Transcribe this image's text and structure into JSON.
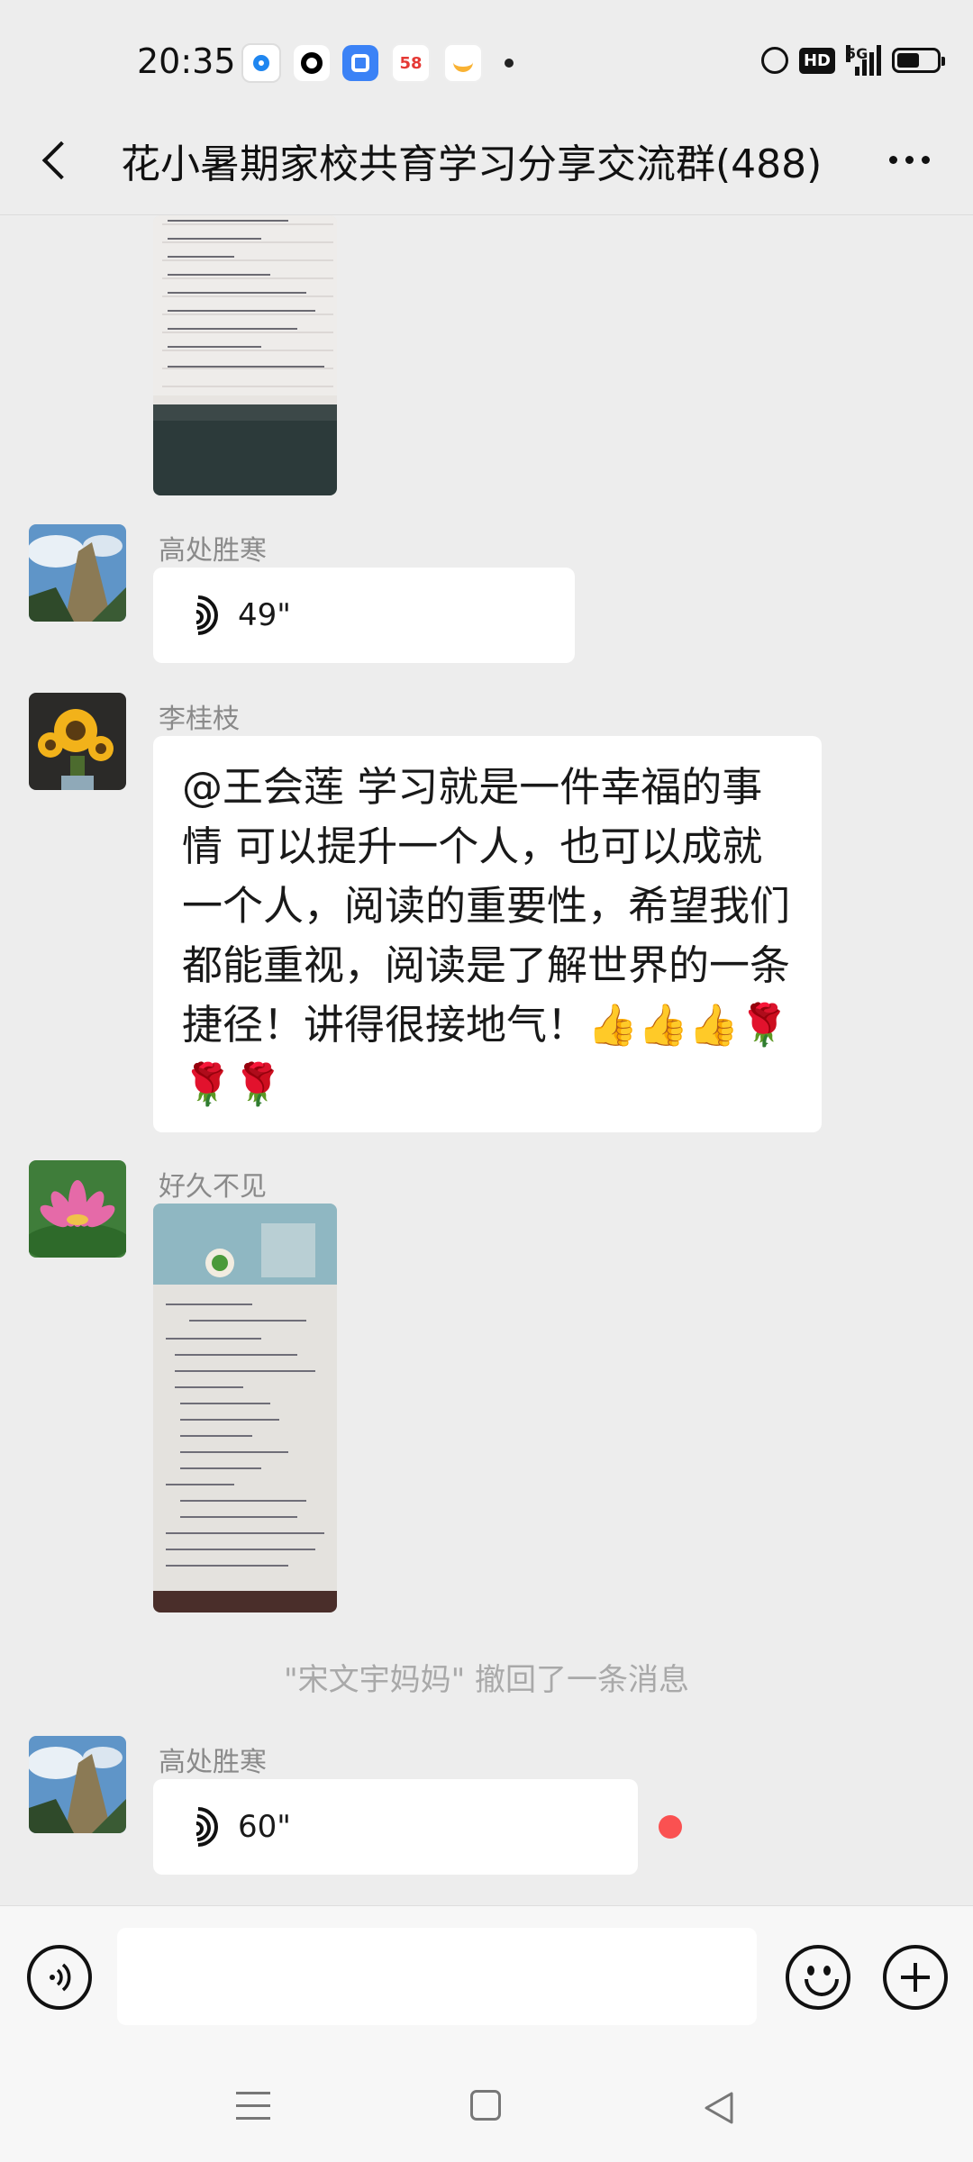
{
  "status_bar": {
    "time": "20:35",
    "notif_58": "58",
    "hd": "HD",
    "network": "5G"
  },
  "header": {
    "title": "花小暑期家校共育学习分享交流群(488)"
  },
  "messages": [
    {
      "type": "image",
      "sender": "",
      "avatar": ""
    },
    {
      "type": "voice",
      "sender": "高处胜寒",
      "duration": "49\"",
      "avatar": "mountain-landscape"
    },
    {
      "type": "text",
      "sender": "李桂枝",
      "text": "@王会莲  学习就是一件幸福的事情 可以提升一个人，也可以成就一个人，阅读的重要性，希望我们都能重视，阅读是了解世界的一条捷径！讲得很接地气！👍👍👍🌹🌹🌹",
      "avatar": "sunflower"
    },
    {
      "type": "image",
      "sender": "好久不见",
      "avatar": "lotus-flower"
    },
    {
      "type": "system",
      "text": "\"宋文宇妈妈\" 撤回了一条消息"
    },
    {
      "type": "voice",
      "sender": "高处胜寒",
      "duration": "60\"",
      "avatar": "mountain-landscape",
      "unread": true
    }
  ],
  "input_bar": {
    "placeholder": ""
  },
  "colors": {
    "background": "#EDEDED",
    "bubble": "#FFFFFF",
    "unread_dot": "#FA5151",
    "nickname": "#8A8A8A",
    "system_text": "#A9A9A9"
  },
  "icons": {
    "back": "chevron-left-icon",
    "more": "more-dots-icon",
    "voice_input": "voice-input-icon",
    "emoji": "emoji-icon",
    "plus": "plus-icon",
    "nav_menu": "menu-icon",
    "nav_home": "home-icon",
    "nav_back": "back-triangle-icon"
  }
}
